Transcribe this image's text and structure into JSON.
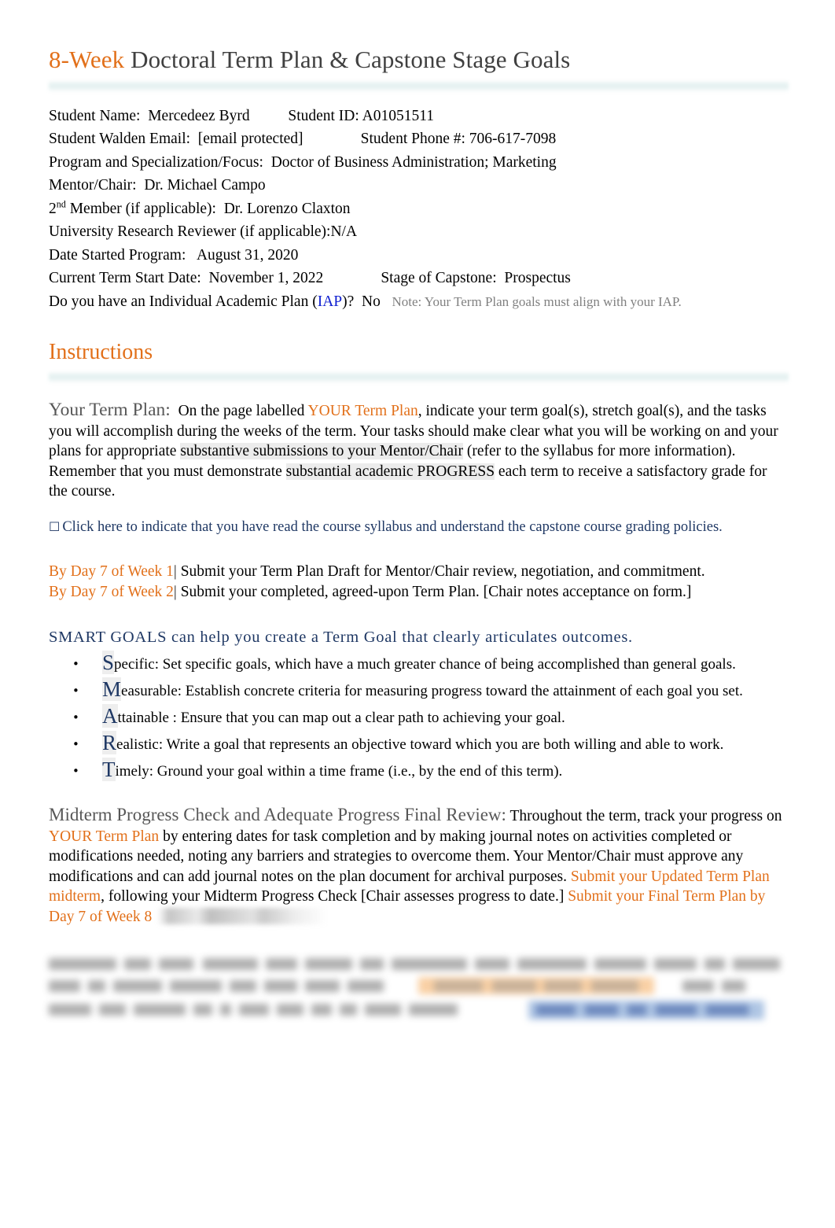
{
  "document": {
    "title_accent": "8-Week",
    "title_rest": "Doctoral Term Plan & Capstone Stage Goals"
  },
  "student_info": {
    "name_label": "Student Name:",
    "name_value": "Mercedeez Byrd",
    "id_label": "Student ID:",
    "id_value": "A01051511",
    "email_label": "Student Walden Email:",
    "email_value": "[email protected]",
    "phone_label": "Student Phone #:",
    "phone_value": "706-617-7098",
    "program_label": "Program and Specialization/Focus:",
    "program_value": "Doctor of Business Administration; Marketing",
    "mentor_label": "Mentor/Chair:",
    "mentor_value": "Dr. Michael Campo",
    "second_member_label_pre": "2",
    "second_member_label_sup": "nd",
    "second_member_label_post": " Member (if applicable):",
    "second_member_value": "Dr. Lorenzo Claxton",
    "urr_label": "University Research Reviewer (if applicable):",
    "urr_value": "N/A",
    "date_started_label": "Date Started Program:",
    "date_started_value": "August 31, 2020",
    "term_start_label": "Current Term Start Date:",
    "term_start_value": "November 1, 2022",
    "stage_label": "Stage of Capstone:",
    "stage_value": "Prospectus",
    "iap_question_pre": "Do you have an Individual Academic Plan (",
    "iap_link": "IAP",
    "iap_question_post": ")?",
    "iap_answer": "No",
    "iap_note": "Note: Your Term Plan goals must align with your IAP."
  },
  "instructions": {
    "heading": "Instructions",
    "term_plan_label": "Your Term Plan:",
    "term_plan_text_1": "On the page labelled ",
    "term_plan_link": "YOUR Term Plan",
    "term_plan_text_2": ", indicate your term goal(s), stretch goal(s), and the tasks you will accomplish during the weeks of the term. Your tasks should make clear what you will be working on and your plans for appropriate ",
    "term_plan_shade_1": "substantive submissions to your Mentor/Chair",
    "term_plan_text_3": " (refer to the syllabus for more information). Remember that you must demonstrate ",
    "term_plan_shade_2": "substantial academic PROGRESS",
    "term_plan_text_4": " each term to receive a satisfactory grade for the course.",
    "checkbox_glyph": "☐",
    "checkbox_text": "Click here to indicate that you have read the course syllabus and understand the capstone course grading policies.",
    "byday_1_label": "By Day 7 of Week 1",
    "byday_1_text": " Submit your Term Plan Draft for Mentor/Chair review, negotiation, and commitment.",
    "byday_2_label": "By Day 7 of Week 2",
    "byday_2_text": " Submit your completed, agreed-upon Term Plan. [Chair notes acceptance on form.]",
    "smart_heading": "SMART GOALS can help you create a Term Goal that clearly articulates outcomes.",
    "smart_items": [
      {
        "bullet": "•",
        "cap": "S",
        "text": "pecific: Set specific goals, which have a much greater chance of being accomplished than general goals."
      },
      {
        "bullet": "•",
        "cap": "M",
        "text": "easurable:  Establish concrete criteria for measuring progress toward the attainment of each goal you set."
      },
      {
        "bullet": "•",
        "cap": "A",
        "text": "ttainable : Ensure that you can map out a clear path to achieving your goal."
      },
      {
        "bullet": "•",
        "cap": "R",
        "text": "ealistic: Write a goal that represents an objective toward which you are both   willing and  able to work."
      },
      {
        "bullet": "•",
        "cap": "T",
        "text": "imely: Ground your goal within a time frame (i.e., by the end of this term)."
      }
    ],
    "midterm_label": "Midterm Progress Check and Adequate Progress Final Review:",
    "midterm_text_1": "  Throughout the term, track your progress on ",
    "midterm_link_1": "YOUR Term Plan",
    "midterm_text_2": " by entering dates for task completion and by making journal notes on activities completed or modifications needed, noting any barriers and strategies to overcome them. Your Mentor/Chair must approve any modifications and can add journal notes on the plan document for archival purposes. ",
    "midterm_link_2": "Submit your Updated Term Plan midterm",
    "midterm_text_3": ", following your Midterm Progress Check ",
    "midterm_text_4": "[Chair assesses progress to date.] ",
    "midterm_link_3": "Submit your Final Term Plan by Day 7 of Week 8"
  },
  "colors": {
    "accent_orange": "#E2701A",
    "navy": "#1F3864",
    "link_blue": "#1020D0",
    "heading_gray": "#575757",
    "divider_teal": "#DFEEEE"
  }
}
